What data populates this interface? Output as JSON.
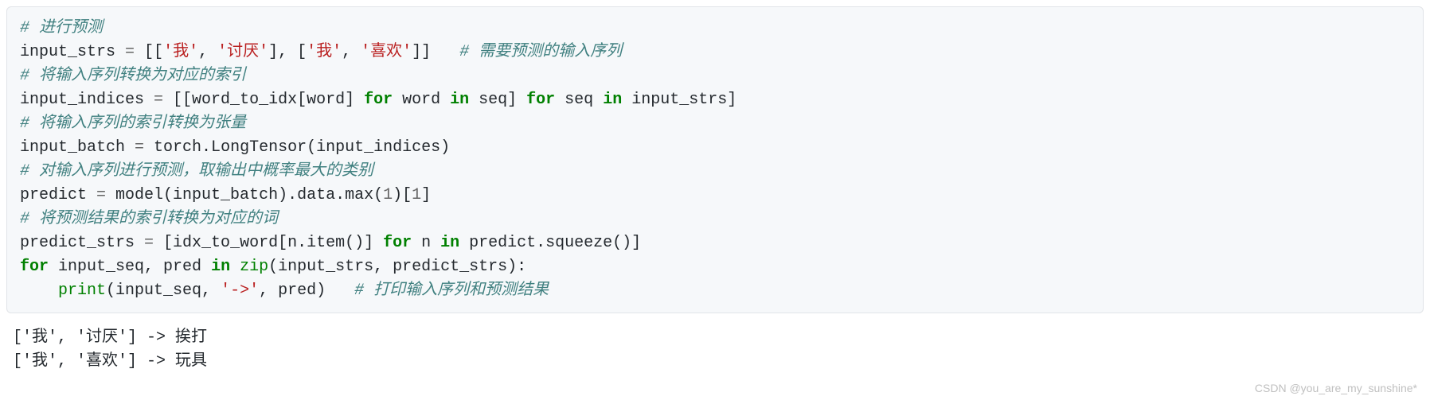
{
  "code": {
    "line1_comment": "# 进行预测",
    "line2_var": "input_strs ",
    "line2_eq": "=",
    "line2_open": " [[",
    "line2_s1": "'我'",
    "line2_c1": ", ",
    "line2_s2": "'讨厌'",
    "line2_mid": "], [",
    "line2_s3": "'我'",
    "line2_c2": ", ",
    "line2_s4": "'喜欢'",
    "line2_close": "]]   ",
    "line2_comment": "# 需要预测的输入序列",
    "line3_comment": "# 将输入序列转换为对应的索引",
    "line4_var": "input_indices ",
    "line4_eq": "=",
    "line4_open": " [[word_to_idx[word] ",
    "line4_for1": "for",
    "line4_p1": " word ",
    "line4_in1": "in",
    "line4_p2": " seq] ",
    "line4_for2": "for",
    "line4_p3": " seq ",
    "line4_in2": "in",
    "line4_p4": " input_strs]",
    "line5_comment": "# 将输入序列的索引转换为张量",
    "line6_var": "input_batch ",
    "line6_eq": "=",
    "line6_rest": " torch.LongTensor(input_indices)",
    "line7_comment": "# 对输入序列进行预测，取输出中概率最大的类别",
    "line8_var": "predict ",
    "line8_eq": "=",
    "line8_p1": " model(input_batch).data.max(",
    "line8_n1": "1",
    "line8_p2": ")[",
    "line8_n2": "1",
    "line8_p3": "]",
    "line9_comment": "# 将预测结果的索引转换为对应的词",
    "line10_var": "predict_strs ",
    "line10_eq": "=",
    "line10_p1": " [idx_to_word[n.item()] ",
    "line10_for": "for",
    "line10_p2": " n ",
    "line10_in": "in",
    "line10_p3": " predict.squeeze()]",
    "line11_for": "for",
    "line11_p1": " input_seq, pred ",
    "line11_in": "in",
    "line11_p2": " ",
    "line11_zip": "zip",
    "line11_p3": "(input_strs, predict_strs):",
    "line12_indent": "    ",
    "line12_print": "print",
    "line12_p1": "(input_seq, ",
    "line12_arrow": "'->'",
    "line12_p2": ", pred)   ",
    "line12_comment": "# 打印输入序列和预测结果"
  },
  "output": {
    "line1": "['我', '讨厌'] -> 挨打",
    "line2": "['我', '喜欢'] -> 玩具"
  },
  "watermark": "CSDN @you_are_my_sunshine*"
}
